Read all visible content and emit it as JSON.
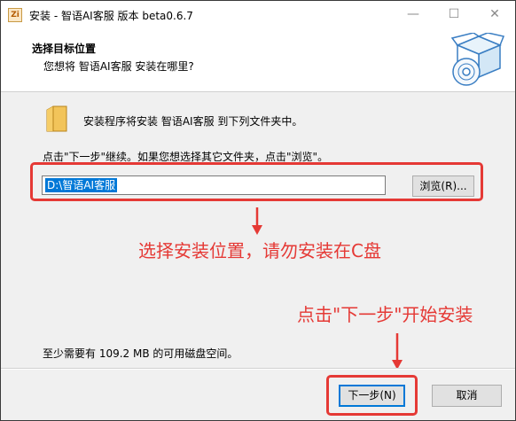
{
  "window": {
    "app_icon_text": "Zi",
    "title": "安装 - 智语AI客服 版本 beta0.6.7",
    "minimize_glyph": "—",
    "maximize_glyph": "☐",
    "close_glyph": "✕"
  },
  "header": {
    "title": "选择目标位置",
    "subtitle": "您想将 智语AI客服 安装在哪里?",
    "image_icon": "installer-box-cd-icon"
  },
  "main": {
    "folder_icon": "folder-icon",
    "intro": "安装程序将安装 智语AI客服 到下列文件夹中。",
    "instruction": "点击\"下一步\"继续。如果您想选择其它文件夹，点击\"浏览\"。",
    "path_value": "D:\\智语AI客服",
    "browse_label": "浏览(R)...",
    "space_required": "至少需要有 109.2 MB 的可用磁盘空间。"
  },
  "annotations": {
    "location_note": "选择安装位置，请勿安装在C盘",
    "next_note": "点击\"下一步\"开始安装",
    "color": "#e53935"
  },
  "footer": {
    "next_label": "下一步(N)",
    "cancel_label": "取消"
  },
  "colors": {
    "accent": "#0078d7",
    "annotation_red": "#e53935"
  }
}
